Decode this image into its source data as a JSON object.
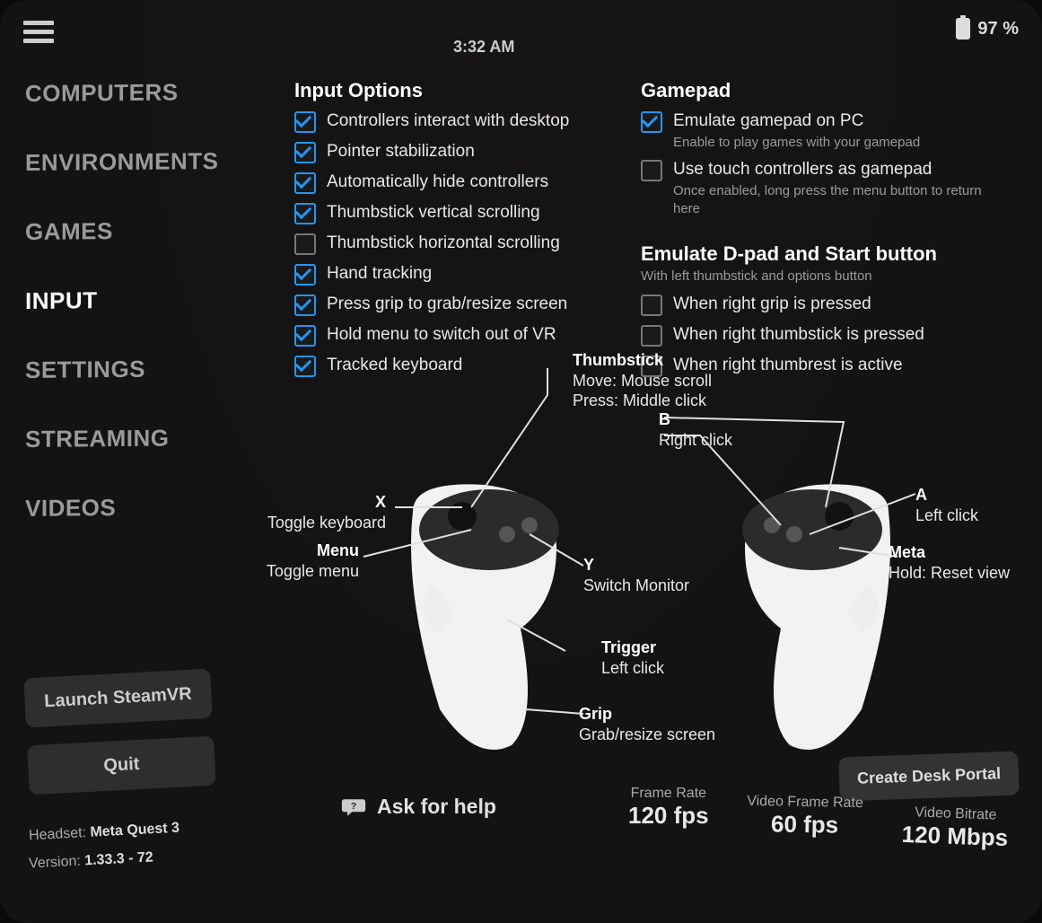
{
  "topbar": {
    "time": "3:32 AM",
    "battery": "97 %"
  },
  "sidebar": {
    "items": [
      "COMPUTERS",
      "ENVIRONMENTS",
      "GAMES",
      "INPUT",
      "SETTINGS",
      "STREAMING",
      "VIDEOS"
    ],
    "active_index": 3,
    "launch_btn": "Launch SteamVR",
    "quit_btn": "Quit"
  },
  "input_options": {
    "heading": "Input Options",
    "items": [
      {
        "label": "Controllers interact with desktop",
        "checked": true
      },
      {
        "label": "Pointer stabilization",
        "checked": true
      },
      {
        "label": "Automatically hide controllers",
        "checked": true
      },
      {
        "label": "Thumbstick vertical scrolling",
        "checked": true
      },
      {
        "label": "Thumbstick horizontal scrolling",
        "checked": false
      },
      {
        "label": "Hand tracking",
        "checked": true
      },
      {
        "label": "Press grip to grab/resize screen",
        "checked": true
      },
      {
        "label": "Hold menu to switch out of VR",
        "checked": true
      },
      {
        "label": "Tracked keyboard",
        "checked": true
      }
    ]
  },
  "gamepad": {
    "heading": "Gamepad",
    "items": [
      {
        "label": "Emulate gamepad on PC",
        "sub": "Enable to play games with your gamepad",
        "checked": true
      },
      {
        "label": "Use touch controllers as gamepad",
        "sub": "Once enabled, long press the menu button to return here",
        "checked": false
      }
    ]
  },
  "dpad": {
    "heading": "Emulate D-pad and Start button",
    "sub": "With left thumbstick and options button",
    "items": [
      {
        "label": "When right grip is pressed",
        "checked": false
      },
      {
        "label": "When right thumbstick is pressed",
        "checked": false
      },
      {
        "label": "When right thumbrest is active",
        "checked": false
      }
    ]
  },
  "diagram": {
    "thumbstick_title": "Thumbstick",
    "thumbstick_l1": "Move: Mouse scroll",
    "thumbstick_l2": "Press: Middle click",
    "b_title": "B",
    "b_sub": "Right click",
    "a_title": "A",
    "a_sub": "Left click",
    "meta_title": "Meta",
    "meta_sub": "Hold: Reset view",
    "x_title": "X",
    "x_sub": "Toggle keyboard",
    "menu_title": "Menu",
    "menu_sub": "Toggle menu",
    "y_title": "Y",
    "y_sub": "Switch Monitor",
    "trigger_title": "Trigger",
    "trigger_sub": "Left click",
    "grip_title": "Grip",
    "grip_sub": "Grab/resize screen"
  },
  "footer": {
    "ask": "Ask for help",
    "create_portal": "Create Desk Portal",
    "frame_rate_label": "Frame Rate",
    "frame_rate_val": "120 fps",
    "video_frame_label": "Video Frame Rate",
    "video_frame_val": "60 fps",
    "video_bitrate_label": "Video Bitrate",
    "video_bitrate_val": "120 Mbps",
    "headset_label": "Headset:",
    "headset_val": "Meta Quest 3",
    "version_label": "Version:",
    "version_val": "1.33.3 - 72"
  }
}
